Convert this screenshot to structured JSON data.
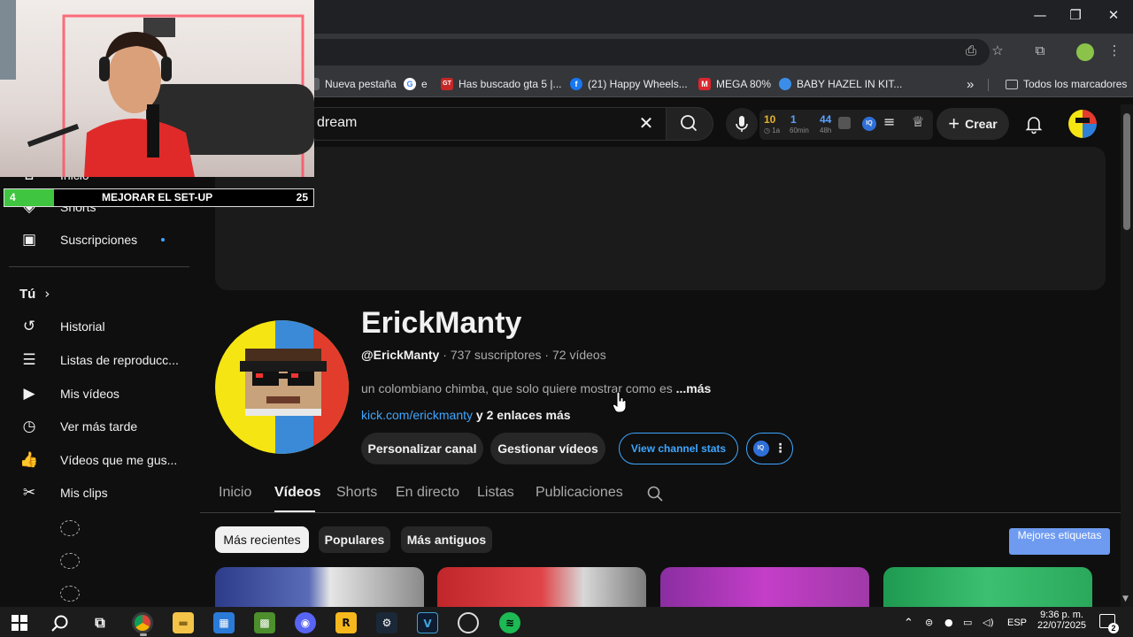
{
  "browser": {
    "window_controls": {
      "minimize": "—",
      "maximize": "❐",
      "close": "✕"
    },
    "bookmarks": [
      {
        "label": "Nueva pestaña",
        "icon": "page-icon",
        "color": "#5f6368"
      },
      {
        "label": "e",
        "icon": "google-icon",
        "color": "#4285f4"
      },
      {
        "label": "Has buscado gta 5 |...",
        "icon": "gt-icon",
        "color": "#c62828"
      },
      {
        "label": "(21) Happy Wheels...",
        "icon": "facebook-icon",
        "color": "#1877f2"
      },
      {
        "label": "MEGA 80%",
        "icon": "mega-icon",
        "color": "#d9272e"
      },
      {
        "label": "BABY HAZEL IN KIT...",
        "icon": "baby-icon",
        "color": "#3b8ee8"
      }
    ],
    "bookmarks_overflow": "»",
    "all_bookmarks": "Todos los marcadores"
  },
  "youtube": {
    "search_value": "dream",
    "create_label": "Crear",
    "stats": [
      {
        "value": "10",
        "label": "1a",
        "color": "#e6b32d"
      },
      {
        "value": "1",
        "label": "60min",
        "color": "#5aa2ff"
      },
      {
        "value": "44",
        "label": "48h",
        "color": "#5aa2ff"
      }
    ]
  },
  "sidebar": {
    "top_items": [
      {
        "label": "Inicio",
        "icon": "home-icon"
      },
      {
        "label": "Shorts",
        "icon": "shorts-icon"
      },
      {
        "label": "Suscripciones",
        "icon": "subscriptions-icon"
      }
    ],
    "you_header": "Tú",
    "you_items": [
      {
        "label": "Historial",
        "icon": "history-icon"
      },
      {
        "label": "Listas de reproducc...",
        "icon": "playlists-icon"
      },
      {
        "label": "Mis vídeos",
        "icon": "my-videos-icon"
      },
      {
        "label": "Ver más tarde",
        "icon": "watch-later-icon"
      },
      {
        "label": "Vídeos que me gus...",
        "icon": "liked-icon"
      },
      {
        "label": "Mis clips",
        "icon": "clips-icon"
      }
    ]
  },
  "channel": {
    "name": "ErickManty",
    "handle": "@ErickManty",
    "subscribers": "737 suscriptores",
    "videos": "72 vídeos",
    "description": "un colombiano chimba, que solo quiere mostrar como es",
    "more": "...más",
    "link": "kick.com/erickmanty",
    "more_links": "y 2 enlaces más",
    "buttons": {
      "customize": "Personalizar canal",
      "manage": "Gestionar vídeos",
      "stats": "View channel stats"
    },
    "tabs": [
      "Inicio",
      "Vídeos",
      "Shorts",
      "En directo",
      "Listas",
      "Publicaciones"
    ],
    "active_tab": "Vídeos",
    "chips": [
      "Más recientes",
      "Populares",
      "Más antiguos"
    ],
    "best_tags": "Mejores etiquetas"
  },
  "overlay": {
    "left_number": "4",
    "goal_text": "MEJORAR EL SET-UP",
    "right_number": "25",
    "progress": 0.16
  },
  "taskbar": {
    "language": "ESP",
    "time": "9:36 p. m.",
    "date": "22/07/2025",
    "notifications": "2"
  }
}
